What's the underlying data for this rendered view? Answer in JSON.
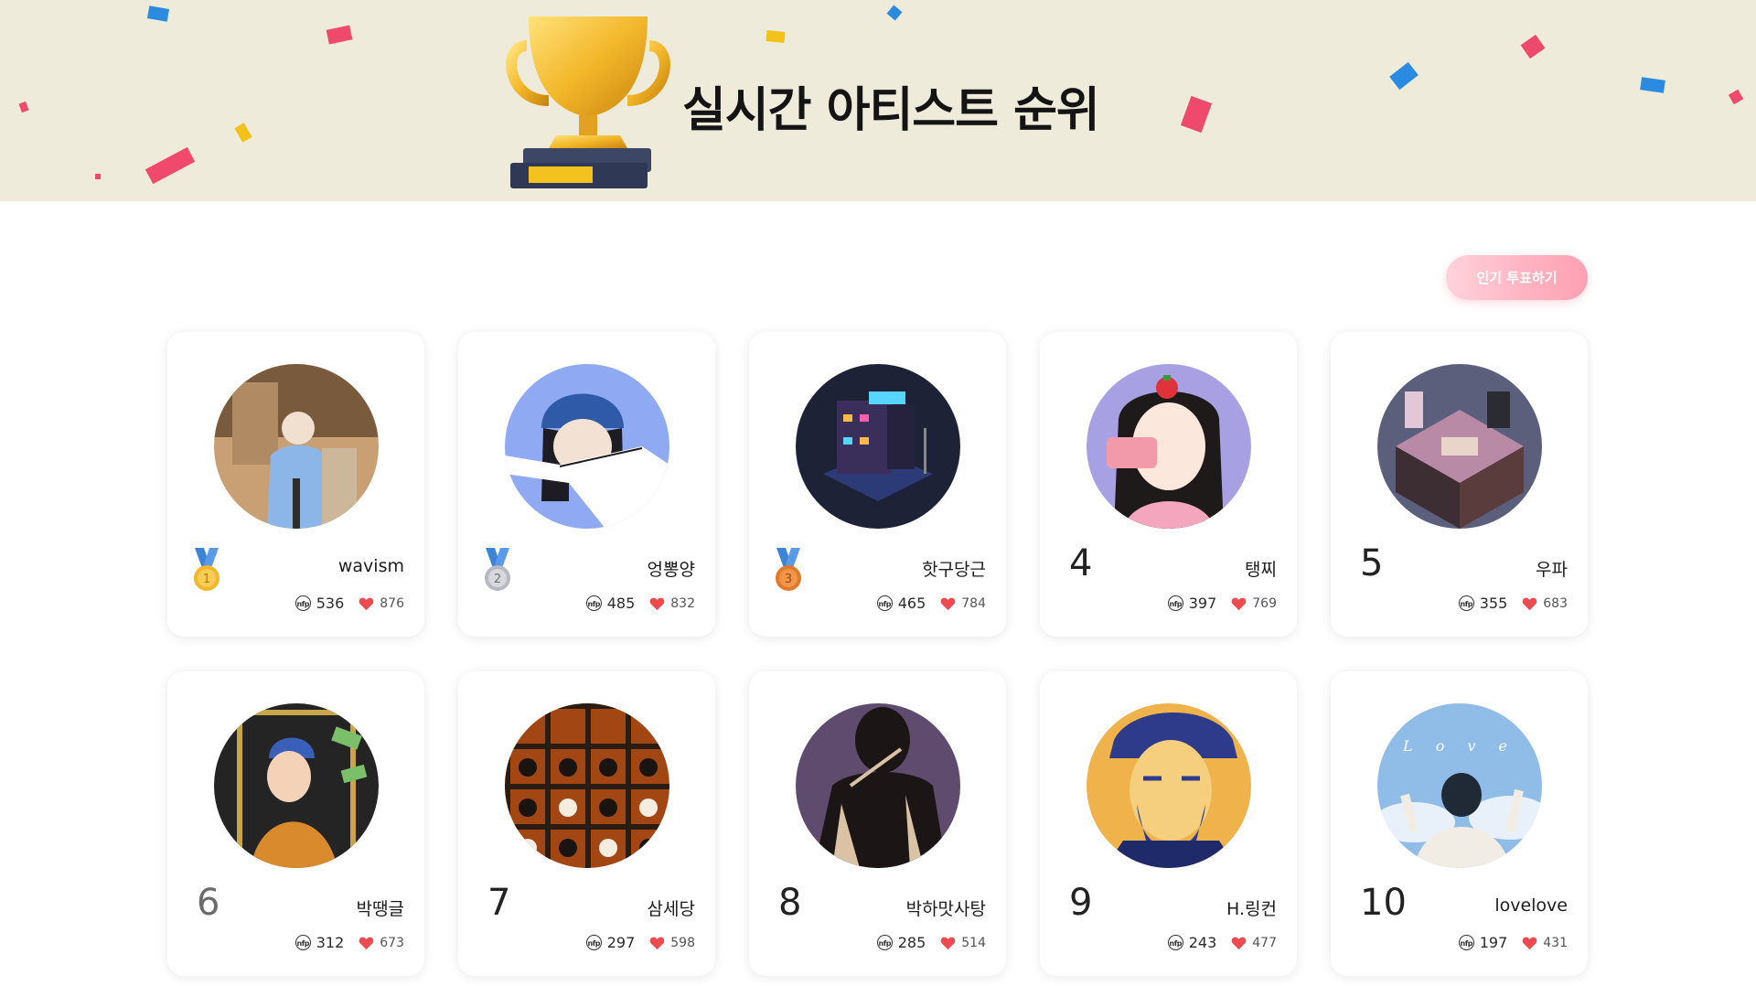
{
  "banner": {
    "title": "실시간 아티스트 순위",
    "trophy_icon": "trophy-icon"
  },
  "vote_button": {
    "label": "인기 투표하기"
  },
  "artists": [
    {
      "rank": "1",
      "medal": "gold",
      "name": "wavism",
      "nft": "536",
      "likes": "876",
      "avatar_colors": [
        "#c9a073",
        "#8cb6e8"
      ]
    },
    {
      "rank": "2",
      "medal": "silver",
      "name": "엉뽕양",
      "nft": "485",
      "likes": "832",
      "avatar_colors": [
        "#8fa9f2",
        "#3a5fa0"
      ]
    },
    {
      "rank": "3",
      "medal": "bronze",
      "name": "핫구당근",
      "nft": "465",
      "likes": "784",
      "avatar_colors": [
        "#1e2236",
        "#5a6cd6"
      ]
    },
    {
      "rank": "4",
      "medal": "",
      "name": "탱찌",
      "nft": "397",
      "likes": "769",
      "avatar_colors": [
        "#a7a0e2",
        "#1f1a1a"
      ]
    },
    {
      "rank": "5",
      "medal": "",
      "name": "우파",
      "nft": "355",
      "likes": "683",
      "avatar_colors": [
        "#5b5f7c",
        "#b98aa5"
      ]
    },
    {
      "rank": "6",
      "medal": "",
      "name": "박땡글",
      "nft": "312",
      "likes": "673",
      "avatar_colors": [
        "#242424",
        "#d98a2c"
      ]
    },
    {
      "rank": "7",
      "medal": "",
      "name": "삼세당",
      "nft": "297",
      "likes": "598",
      "avatar_colors": [
        "#a24614",
        "#2a1c12"
      ]
    },
    {
      "rank": "8",
      "medal": "",
      "name": "박하맛사탕",
      "nft": "285",
      "likes": "514",
      "avatar_colors": [
        "#5e4b6e",
        "#1b1515"
      ]
    },
    {
      "rank": "9",
      "medal": "",
      "name": "H.링컨",
      "nft": "243",
      "likes": "477",
      "avatar_colors": [
        "#f0b24a",
        "#2e3b8a"
      ]
    },
    {
      "rank": "10",
      "medal": "",
      "name": "lovelove",
      "nft": "197",
      "likes": "431",
      "avatar_colors": [
        "#8fbde8",
        "#f2ede4"
      ]
    }
  ],
  "colors": {
    "banner_bg": "#efebda",
    "heart": "#ef4a4f",
    "vote_button": "#ffb1c1"
  }
}
